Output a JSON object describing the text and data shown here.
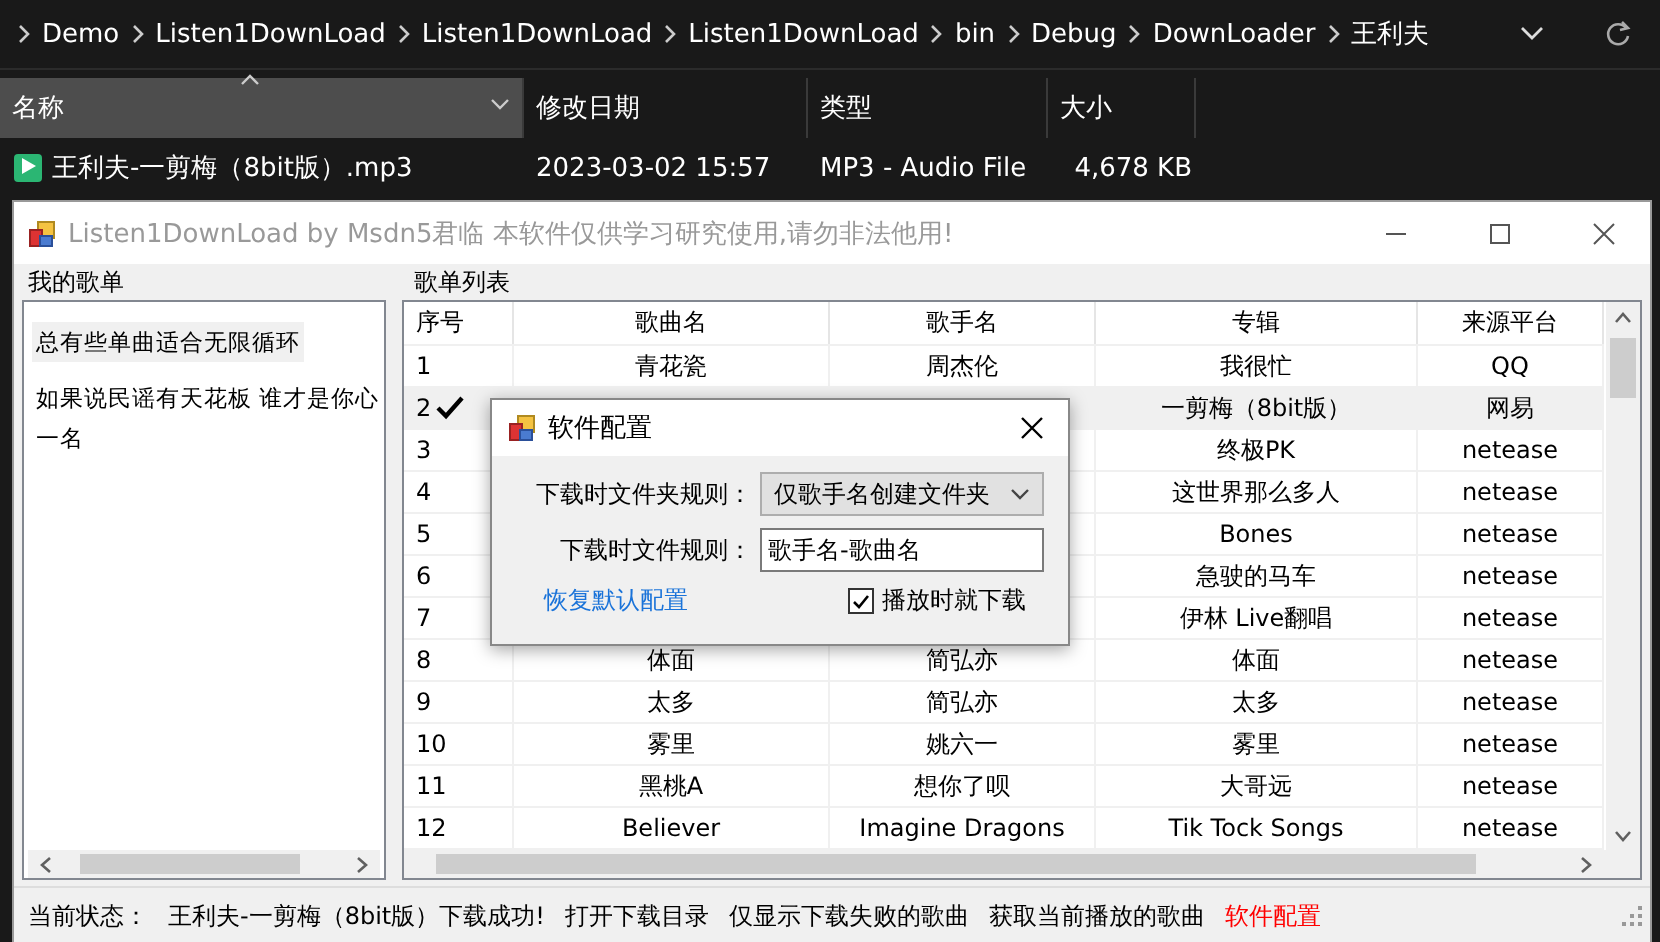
{
  "explorer": {
    "breadcrumbs": [
      "Demo",
      "Listen1DownLoad",
      "Listen1DownLoad",
      "Listen1DownLoad",
      "bin",
      "Debug",
      "DownLoader",
      "王利夫"
    ],
    "columns": [
      {
        "label": "名称",
        "highlighted": true,
        "sorted": true
      },
      {
        "label": "修改日期",
        "highlighted": false,
        "sorted": false
      },
      {
        "label": "类型",
        "highlighted": false,
        "sorted": false
      },
      {
        "label": "大小",
        "highlighted": false,
        "sorted": false
      }
    ],
    "files": [
      {
        "name": "王利夫-一剪梅（8bit版）.mp3",
        "modified": "2023-03-02 15:57",
        "type": "MP3 - Audio File",
        "size": "4,678 KB"
      }
    ]
  },
  "window": {
    "title": "Listen1DownLoad by Msdn5君临 本软件仅供学习研究使用,请勿非法他用!"
  },
  "playlists": {
    "title": "我的歌单",
    "items": [
      {
        "lines": [
          "总有些单曲适合无限循环"
        ],
        "selected": true
      },
      {
        "lines": [
          "如果说民谣有天花板 谁才是你心",
          "一名"
        ],
        "selected": false
      }
    ]
  },
  "table": {
    "title": "歌单列表",
    "columns": [
      "序号",
      "歌曲名",
      "歌手名",
      "专辑",
      "来源平台"
    ],
    "rows": [
      {
        "no": "1",
        "song": "青花瓷",
        "singer": "周杰伦",
        "album": "我很忙",
        "source": "QQ",
        "selected": false,
        "playing": false
      },
      {
        "no": "2",
        "album": "一剪梅（8bit版）",
        "source": "网易",
        "selected": true,
        "playing": true
      },
      {
        "no": "3",
        "album": "终极PK",
        "source": "netease",
        "selected": false,
        "playing": false
      },
      {
        "no": "4",
        "album": "这世界那么多人",
        "source": "netease",
        "selected": false,
        "playing": false
      },
      {
        "no": "5",
        "album": "Bones",
        "source": "netease",
        "selected": false,
        "playing": false
      },
      {
        "no": "6",
        "album": "急驶的马车",
        "source": "netease",
        "selected": false,
        "playing": false
      },
      {
        "no": "7",
        "album": "伊林 Live翻唱",
        "source": "netease",
        "selected": false,
        "playing": false
      },
      {
        "no": "8",
        "song": "体面",
        "singer": "简弘亦",
        "album": "体面",
        "source": "netease",
        "selected": false,
        "playing": false
      },
      {
        "no": "9",
        "song": "太多",
        "singer": "简弘亦",
        "album": "太多",
        "source": "netease",
        "selected": false,
        "playing": false
      },
      {
        "no": "10",
        "song": "雾里",
        "singer": "姚六一",
        "album": "雾里",
        "source": "netease",
        "selected": false,
        "playing": false
      },
      {
        "no": "11",
        "song": "黑桃A",
        "singer": "想你了呗",
        "album": "大哥远",
        "source": "netease",
        "selected": false,
        "playing": false
      },
      {
        "no": "12",
        "song": "Believer",
        "singer": "Imagine Dragons",
        "album": "Tik Tock Songs",
        "source": "netease",
        "selected": false,
        "playing": false
      }
    ]
  },
  "dialog": {
    "title": "软件配置",
    "folder_rule_label": "下载时文件夹规则：",
    "folder_rule": "仅歌手名创建文件夹",
    "file_rule_label": "下载时文件规则：",
    "file_rule": "歌手名-歌曲名",
    "reset_link": "恢复默认配置",
    "download_on_play": {
      "label": "播放时就下载",
      "checked": true
    }
  },
  "status_bar": [
    {
      "kind": "label",
      "text": "当前状态："
    },
    {
      "kind": "message",
      "text": "王利夫-一剪梅（8bit版）下载成功!"
    },
    {
      "kind": "link",
      "text": "打开下载目录",
      "highlighted": false
    },
    {
      "kind": "link",
      "text": "仅显示下载失败的歌曲",
      "highlighted": false
    },
    {
      "kind": "link",
      "text": "获取当前播放的歌曲",
      "highlighted": false
    },
    {
      "kind": "link",
      "text": "软件配置",
      "highlighted": true
    }
  ]
}
